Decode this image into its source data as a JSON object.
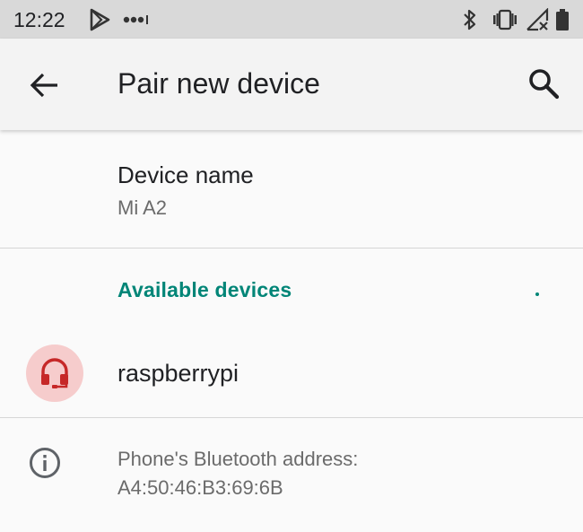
{
  "status_bar": {
    "time": "12:22",
    "icons": [
      "play-store-icon",
      "more-notifications-icon",
      "bluetooth-icon",
      "vibrate-icon",
      "signal-off-icon",
      "battery-icon"
    ]
  },
  "app_bar": {
    "title": "Pair new device",
    "back_icon": "arrow-back-icon",
    "search_icon": "search-icon"
  },
  "device_name": {
    "title": "Device name",
    "value": "Mi A2"
  },
  "available_devices": {
    "header": "Available devices",
    "items": [
      {
        "label": "raspberrypi",
        "icon": "headset-icon"
      }
    ]
  },
  "bluetooth_info": {
    "icon": "info-icon",
    "label": "Phone's Bluetooth address:",
    "value": "A4:50:46:B3:69:6B"
  },
  "colors": {
    "accent": "#008577",
    "avatar_bg": "#f6cccc",
    "avatar_icon": "#c62828",
    "status_bar_bg": "#d9d9d9",
    "app_bar_bg": "#f3f3f3"
  }
}
